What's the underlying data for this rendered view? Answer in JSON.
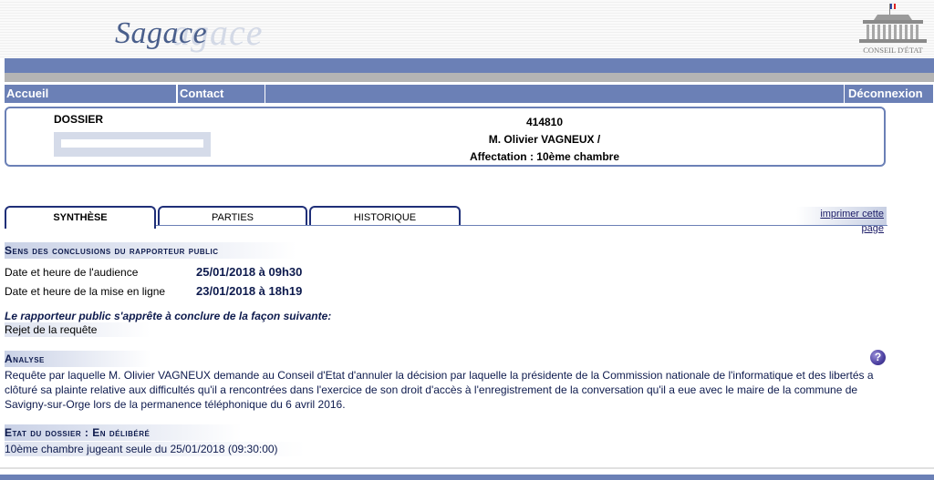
{
  "brand": {
    "title": "Sagace",
    "ghost": "agace",
    "ce_caption": "CONSEIL D'ÉTAT"
  },
  "nav": {
    "accueil": "Accueil",
    "contact": "Contact",
    "deconnexion": "Déconnexion"
  },
  "dossier": {
    "label": "DOSSIER",
    "number": "414810",
    "name": "M. Olivier VAGNEUX /",
    "affectation": "Affectation : 10ème chambre"
  },
  "tabs": {
    "synthese": "Synthèse",
    "parties": "Parties",
    "historique": "Historique",
    "print": "imprimer cette page"
  },
  "conclusions": {
    "heading": "Sens des conclusions du rapporteur public",
    "audience_label": "Date et heure de l'audience",
    "audience_value": "25/01/2018 à 09h30",
    "online_label": "Date et heure de la mise en ligne",
    "online_value": "23/01/2018 à 18h19",
    "intro": "Le rapporteur public s'apprête à conclure de la façon suivante:",
    "result": "Rejet de la requête"
  },
  "analyse": {
    "heading": "Analyse",
    "help": "?",
    "text": "Requête par laquelle M. Olivier VAGNEUX demande au Conseil d'Etat d'annuler la décision par laquelle la présidente de la Commission nationale de l'informatique et des libertés a clôturé sa plainte relative aux difficultés qu'il a rencontrées dans l'exercice de son droit d'accès à l'enregistrement de la conversation qu'il a eue avec le maire de la commune de Savigny-sur-Orge lors de la permanence téléphonique du 6 avril 2016."
  },
  "etat": {
    "heading": "Etat du dossier : En délibéré",
    "text": "10ème chambre jugeant seule du 25/01/2018 (09:30:00)"
  },
  "colors": {
    "nav_blue": "#6b80b6",
    "text_navy": "#0d1a4d",
    "tab_border": "#1f2f78"
  }
}
